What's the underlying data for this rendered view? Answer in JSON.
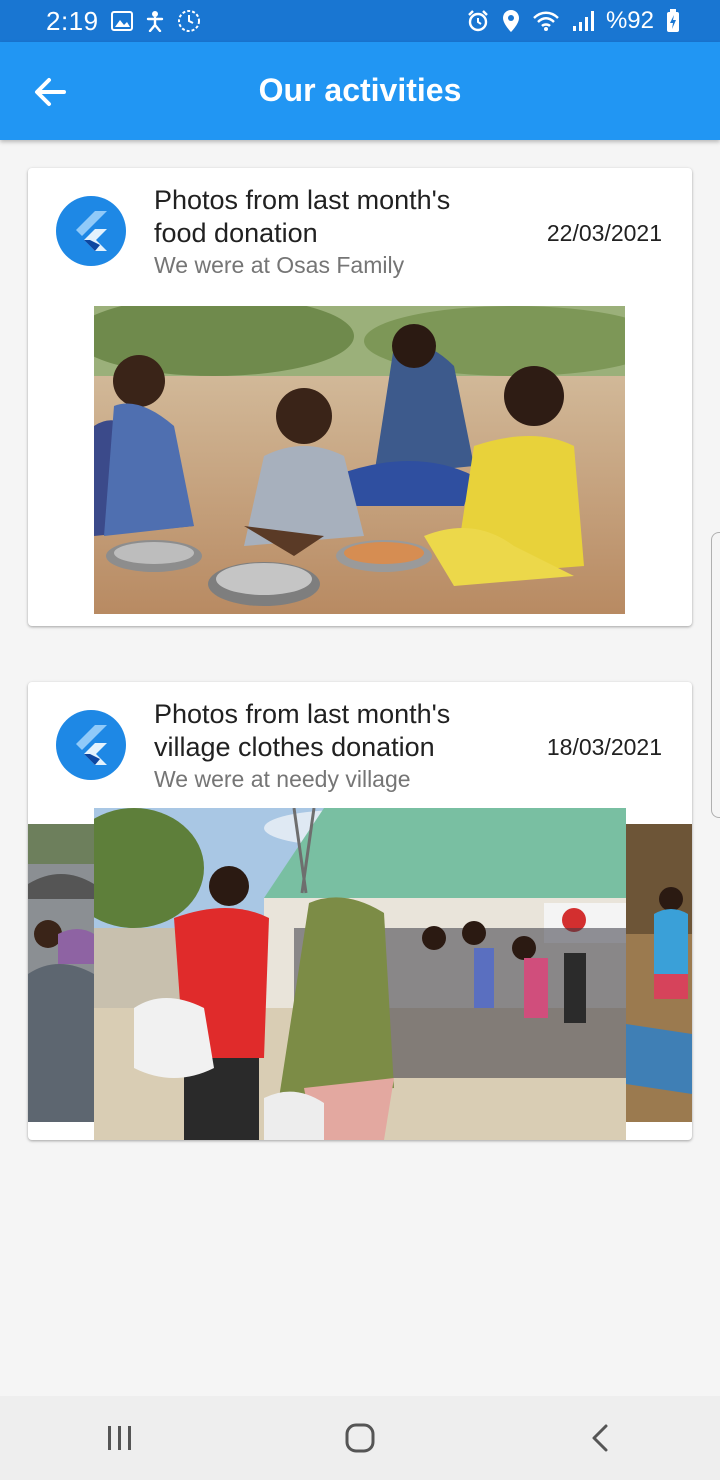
{
  "status_bar": {
    "time": "2:19",
    "left_icons": [
      "gallery-icon",
      "accessibility-icon",
      "sync-icon"
    ],
    "right_icons": [
      "alarm-icon",
      "location-icon",
      "wifi-icon",
      "signal-icon"
    ],
    "battery": "%92"
  },
  "app_bar": {
    "title": "Our activities",
    "color": "#2196f3"
  },
  "activities": [
    {
      "title_line1": "Photos from last month's",
      "title_line2": "food donation",
      "subtitle": "We were at Osas Family",
      "date": "22/03/2021"
    },
    {
      "title_line1": "Photos from last month's",
      "title_line2": "village clothes donation",
      "subtitle": "We were at needy village",
      "date": "18/03/2021"
    }
  ],
  "nav_bar": {
    "icons": [
      "recent-apps-icon",
      "home-icon",
      "back-icon"
    ]
  }
}
